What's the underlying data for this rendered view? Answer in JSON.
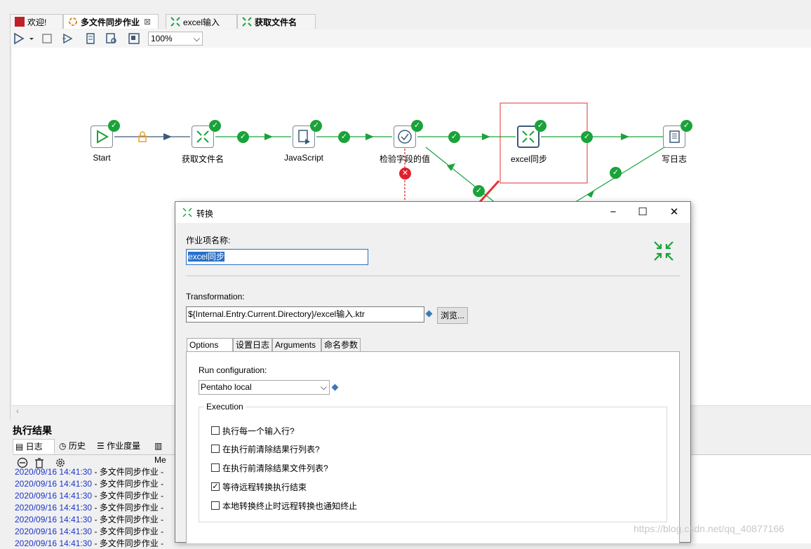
{
  "tabs": [
    {
      "label": "欢迎!",
      "active": false
    },
    {
      "label": "多文件同步作业",
      "active": true,
      "close": "⊠"
    },
    {
      "label": "excel输入",
      "active": false
    },
    {
      "label": "获取文件名",
      "active": false
    }
  ],
  "toolbar": {
    "zoom": "100%"
  },
  "canvas": {
    "nodes": [
      {
        "label": "Start"
      },
      {
        "label": "获取文件名"
      },
      {
        "label": "JavaScript"
      },
      {
        "label": "检验字段的值"
      },
      {
        "label": "excel同步"
      },
      {
        "label": "写日志"
      }
    ]
  },
  "results": {
    "title": "执行结果",
    "tabs": [
      "日志",
      "历史",
      "作业度量",
      "Me"
    ],
    "log_lines": [
      {
        "ts": "2020/09/16 14:41:30",
        "msg": " - 多文件同步作业 -"
      },
      {
        "ts": "2020/09/16 14:41:30",
        "msg": " - 多文件同步作业 -"
      },
      {
        "ts": "2020/09/16 14:41:30",
        "msg": " - 多文件同步作业 -"
      },
      {
        "ts": "2020/09/16 14:41:30",
        "msg": " - 多文件同步作业 -"
      },
      {
        "ts": "2020/09/16 14:41:30",
        "msg": " - 多文件同步作业 -"
      },
      {
        "ts": "2020/09/16 14:41:30",
        "msg": " - 多文件同步作业 -"
      },
      {
        "ts": "2020/09/16 14:41:30",
        "msg": " - 多文件同步作业 -"
      }
    ]
  },
  "dialog": {
    "title": "转换",
    "job_name_label": "作业项名称:",
    "job_name_value": "excel同步",
    "transformation_label": "Transformation:",
    "transformation_value": "${Internal.Entry.Current.Directory}/excel输入.ktr",
    "browse_label": "浏览...",
    "tabs": [
      "Options",
      "设置日志",
      "Arguments",
      "命名参数"
    ],
    "run_config_label": "Run configuration:",
    "run_config_value": "Pentaho local",
    "execution_label": "Execution",
    "options": [
      {
        "label": "执行每一个输入行?",
        "checked": false
      },
      {
        "label": "在执行前清除结果行列表?",
        "checked": false
      },
      {
        "label": "在执行前清除结果文件列表?",
        "checked": false
      },
      {
        "label": "等待远程转换执行结束",
        "checked": true
      },
      {
        "label": "本地转换终止时远程转换也通知终止",
        "checked": false
      }
    ]
  },
  "watermark": "https://blog.csdn.net/qq_40877166",
  "colors": {
    "success": "#1aa33a",
    "error": "#e0202a",
    "highlight_box": "#e03030"
  }
}
